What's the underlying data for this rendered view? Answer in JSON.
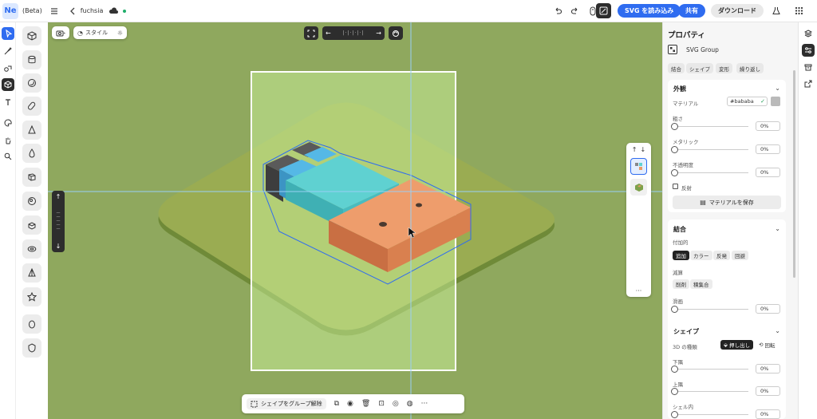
{
  "topbar": {
    "logo": "Ne",
    "beta": "(Beta)",
    "menu_icon": "menu-icon",
    "project_name": "fuchsia",
    "import_svg_label": "SVG を読み込み",
    "share_label": "共有",
    "download_label": "ダウンロード"
  },
  "canvas_toolbar": {
    "style_label": "スタイル"
  },
  "bottom_toolbar": {
    "ungroup_label": "シェイプをグループ解除"
  },
  "properties": {
    "title": "プロパティ",
    "object_name": "SVG Group",
    "tabs": [
      "結合",
      "シェイプ",
      "変形",
      "繰り返し"
    ],
    "appearance": {
      "title": "外観",
      "material_label": "マテリアル",
      "material_value": "#bababa",
      "material_color": "#bababa",
      "roughness_label": "粗さ",
      "roughness_value": "0%",
      "metallic_label": "メタリック",
      "metallic_value": "0%",
      "opacity_label": "不透明度",
      "opacity_value": "0%",
      "reflect_label": "反射",
      "save_material_label": "マテリアルを保存"
    },
    "combine": {
      "title": "結合",
      "add_group_label": "付加的",
      "add_options": [
        "追加",
        "カラー",
        "反発",
        "回避"
      ],
      "subtract_group_label": "減算",
      "subtract_options": [
        "削剤",
        "積集合"
      ],
      "smooth_label": "滑画",
      "smooth_value": "0%"
    },
    "shape": {
      "title": "シェイプ",
      "type_label": "3D の種類",
      "extrude_label": "押し出し",
      "revolve_label": "回転",
      "bottom_label": "下隅",
      "bottom_value": "0%",
      "top_label": "上隅",
      "top_value": "0%",
      "shell_label": "シェル内",
      "shell_value": "0%"
    }
  },
  "colors": {
    "accent": "#2f6cf0",
    "canvas_bg": "#8fa85e",
    "selection": "#9ad0f5"
  }
}
